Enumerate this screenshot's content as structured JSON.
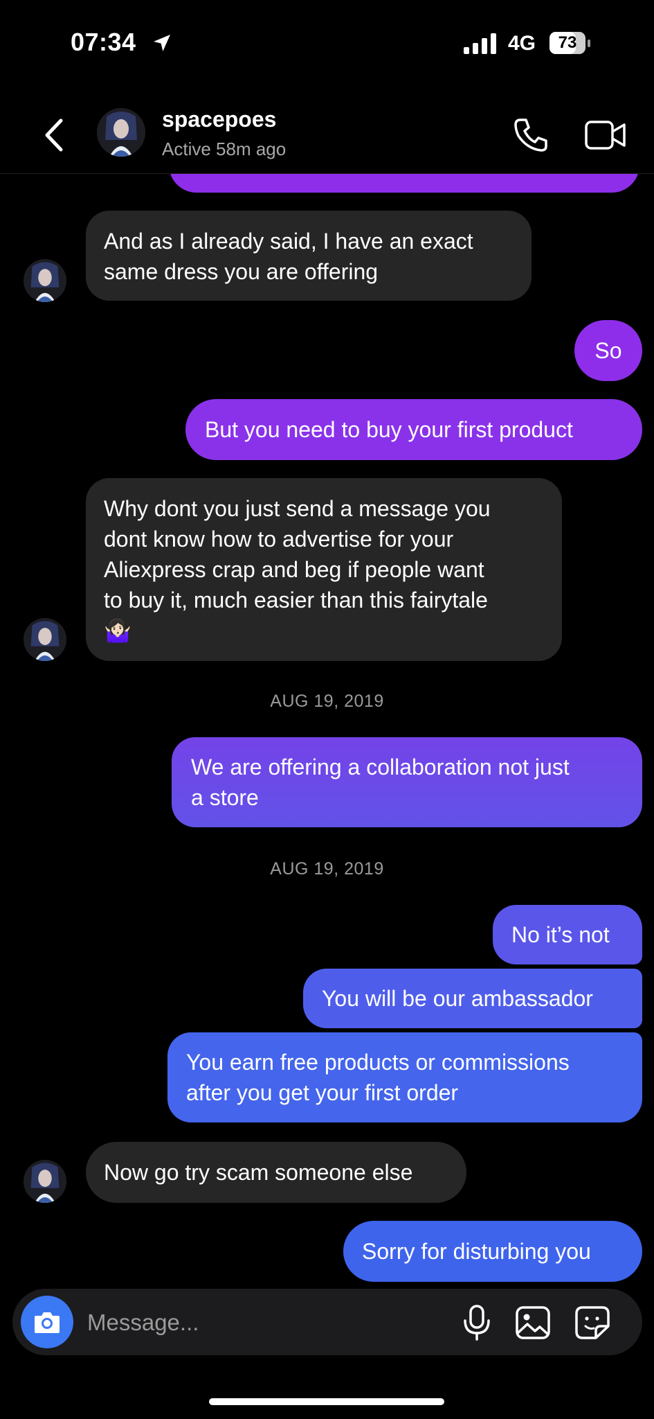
{
  "status_bar": {
    "time": "07:34",
    "network": "4G",
    "battery_percent": "73",
    "battery_level": 0.73,
    "location_icon": "location-arrow-icon",
    "signal_icon": "signal-bars-icon"
  },
  "header": {
    "contact_name": "spacepoes",
    "contact_status": "Active 58m ago",
    "back_icon": "chevron-left-icon",
    "call_icon": "phone-icon",
    "video_icon": "video-camera-icon"
  },
  "colors": {
    "background": "#000000",
    "incoming_bubble": "#262626",
    "outgoing_purple": "#8e2eea",
    "outgoing_violet": "#6a49e8",
    "outgoing_blue": "#3f64ec",
    "camera_button": "#3b78f4",
    "timestamp_text": "#9a9a9a"
  },
  "messages": [
    {
      "direction": "incoming",
      "lines": [
        "And as I already said, I have an exact",
        "same dress you are offering"
      ]
    },
    {
      "direction": "outgoing",
      "lines": [
        "So"
      ]
    },
    {
      "direction": "outgoing",
      "lines": [
        "But you need to buy your first product"
      ]
    },
    {
      "direction": "incoming",
      "lines": [
        "Why dont you just send a message you",
        "dont know how to advertise for your",
        "Aliexpress crap and beg if people want",
        "to buy it, much easier than this fairytale",
        "🤷🏻‍♀️"
      ]
    },
    {
      "direction": "date",
      "text": "AUG 19, 2019"
    },
    {
      "direction": "outgoing",
      "lines": [
        "We are offering a collaboration not just",
        "a store"
      ]
    },
    {
      "direction": "date",
      "text": "AUG 19, 2019"
    },
    {
      "direction": "outgoing",
      "lines": [
        "No it’s not"
      ]
    },
    {
      "direction": "outgoing",
      "lines": [
        "You will be our ambassador"
      ]
    },
    {
      "direction": "outgoing",
      "lines": [
        "You earn free products or commissions",
        "after you get your first order"
      ]
    },
    {
      "direction": "incoming",
      "lines": [
        "Now go try scam someone else"
      ]
    },
    {
      "direction": "outgoing",
      "lines": [
        "Sorry for disturbing you"
      ]
    }
  ],
  "composer": {
    "placeholder": "Message...",
    "camera_icon": "camera-icon",
    "mic_icon": "microphone-icon",
    "gallery_icon": "image-icon",
    "sticker_icon": "sticker-icon"
  }
}
